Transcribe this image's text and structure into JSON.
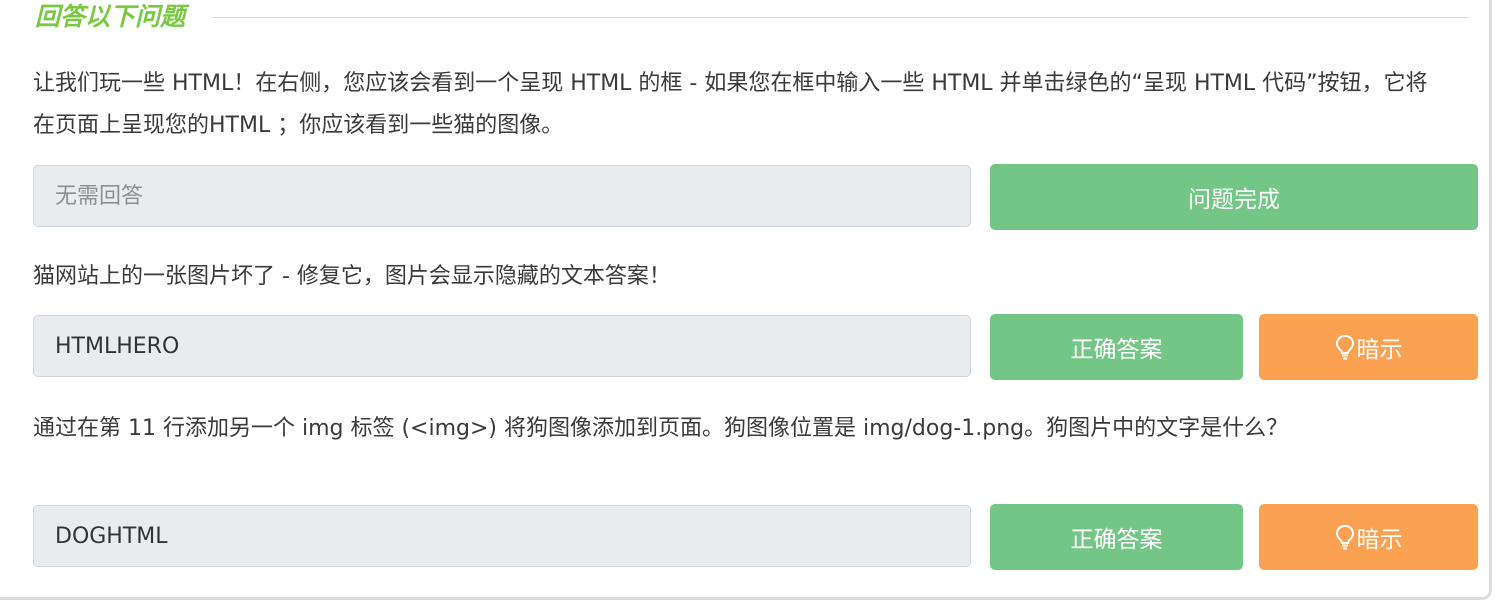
{
  "section": {
    "title": "回答以下问题"
  },
  "questions": [
    {
      "text": "让我们玩一些 HTML！在右侧，您应该会看到一个呈现 HTML 的框 - 如果您在框中输入一些 HTML 并单击绿色的“呈现 HTML 代码”按钮，它将在页面上呈现您的HTML ；你应该看到一些猫的图像。",
      "input_value": "",
      "input_placeholder": "无需回答",
      "submit_label": "问题完成"
    },
    {
      "text": "猫网站上的一张图片坏了 - 修复它，图片会显示隐藏的文本答案！",
      "input_value": "HTMLHERO",
      "input_placeholder": "",
      "submit_label": "正确答案",
      "hint_label": "暗示"
    },
    {
      "text": "通过在第 11 行添加另一个 img 标签 (<img>) 将狗图像添加到页面。狗图像位置是 img/dog-1.png。狗图片中的文字是什么？",
      "input_value": "DOGHTML",
      "input_placeholder": "",
      "submit_label": "正确答案",
      "hint_label": "暗示"
    }
  ],
  "icons": {
    "hint": "lightbulb-icon"
  },
  "colors": {
    "title_green": "#7ac943",
    "button_green": "#74c687",
    "button_orange": "#fba252",
    "input_bg": "#e9ecef"
  }
}
